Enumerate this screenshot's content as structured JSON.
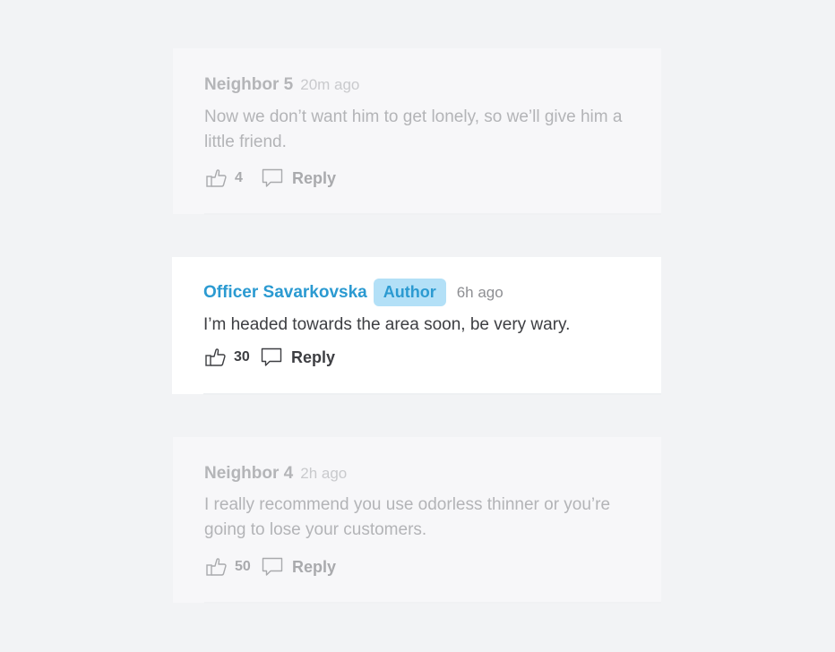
{
  "comments": [
    {
      "author": "Neighbor 5",
      "badge": "",
      "time": "20m ago",
      "text": "Now we don’t want him to get lonely, so we’ll give him a little friend.",
      "likes": "4",
      "reply_label": "Reply"
    },
    {
      "author": "Officer Savarkovska",
      "badge": "Author",
      "time": "6h ago",
      "text": "I’m headed towards the area soon, be very wary.",
      "likes": "30",
      "reply_label": "Reply"
    },
    {
      "author": "Neighbor 4",
      "badge": "",
      "time": "2h ago",
      "text": "I really recommend you use odorless thinner or you’re going to lose your customers.",
      "likes": "50",
      "reply_label": "Reply"
    }
  ],
  "icons": {
    "like": "thumbs-up-icon",
    "reply": "speech-bubble-icon"
  },
  "colors": {
    "page_background": "#f2f3f5",
    "author_accent": "#2b9ad1",
    "badge_background": "#b3e0f7",
    "faded_text": "#b3b4b7",
    "active_text": "#3d3e42"
  }
}
